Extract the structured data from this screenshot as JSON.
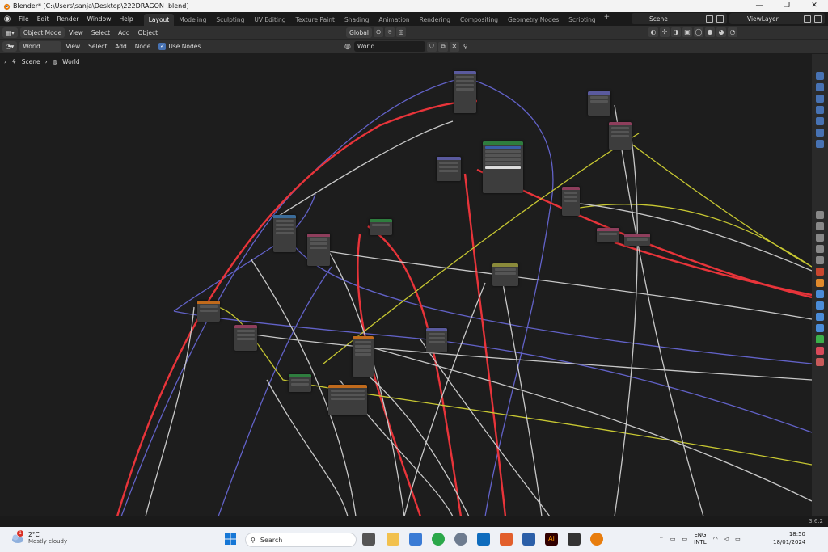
{
  "window": {
    "title": "Blender* [C:\\Users\\sanja\\Desktop\\222DRAGON .blend]",
    "minimize": "—",
    "maximize": "❐",
    "close": "✕"
  },
  "topbar": {
    "menus": [
      "File",
      "Edit",
      "Render",
      "Window",
      "Help"
    ],
    "workspaces": [
      "Layout",
      "Modeling",
      "Sculpting",
      "UV Editing",
      "Texture Paint",
      "Shading",
      "Animation",
      "Rendering",
      "Compositing",
      "Geometry Nodes",
      "Scripting"
    ],
    "active_workspace": "Layout",
    "add_workspace": "+",
    "scene": "Scene",
    "view_layer": "ViewLayer"
  },
  "header1": {
    "mode": "Object Mode",
    "menus": [
      "View",
      "Select",
      "Add",
      "Object"
    ],
    "orientation": "Global"
  },
  "header2": {
    "shader_type": "World",
    "menus": [
      "View",
      "Select",
      "Add",
      "Node"
    ],
    "use_nodes_label": "Use Nodes",
    "world_name": "World"
  },
  "breadcrumb": [
    "Scene",
    "World"
  ],
  "status": {
    "version": "3.6.2"
  },
  "taskbar": {
    "temperature": "2°C",
    "weather": "Mostly cloudy",
    "weather_badge": "1",
    "search_placeholder": "Search",
    "language": "ENG",
    "layout": "INTL",
    "time": "18:50",
    "date": "18/01/2024"
  },
  "colors": {
    "accent_blue": "#4772b3",
    "link_red": "#e8343a",
    "link_purple": "#6262c8",
    "link_white": "#c8c8c8",
    "link_yellow": "#c8c832"
  }
}
